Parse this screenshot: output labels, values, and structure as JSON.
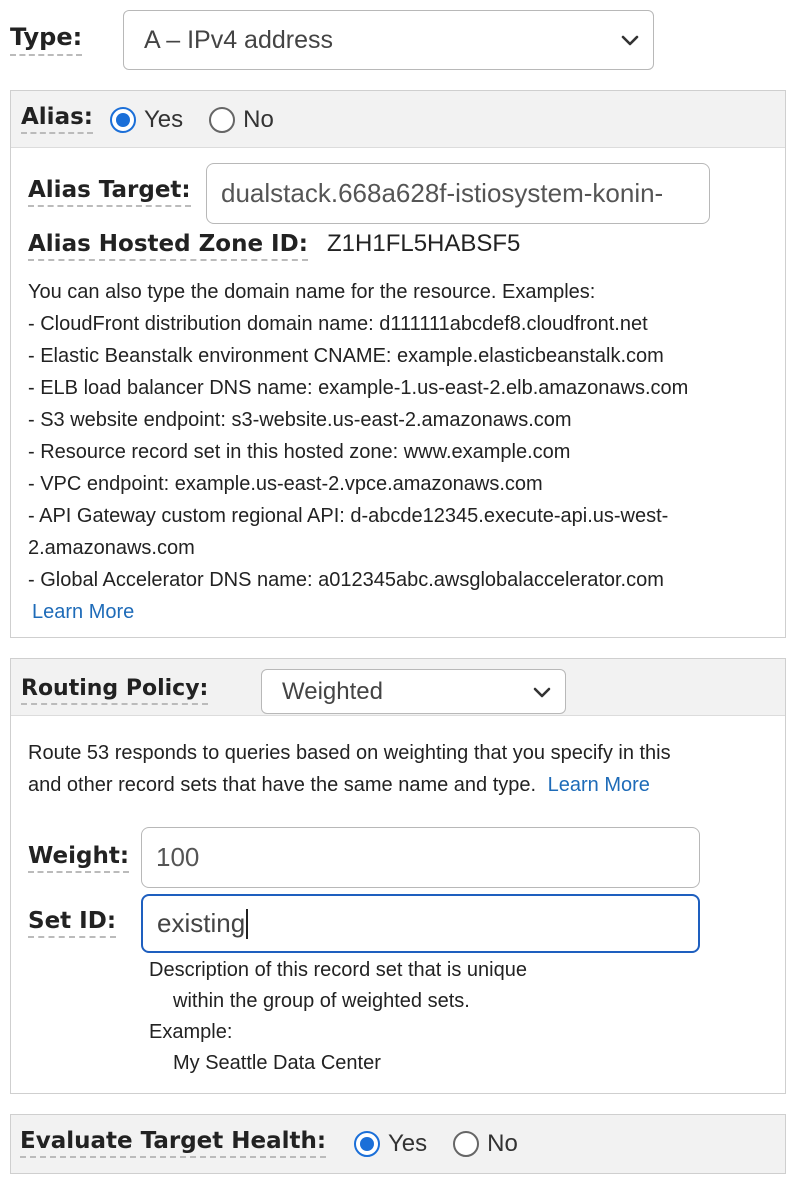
{
  "type_row": {
    "label": "Type:",
    "selected": "A – IPv4 address"
  },
  "alias": {
    "label": "Alias:",
    "options": [
      {
        "label": "Yes",
        "checked": true
      },
      {
        "label": "No",
        "checked": false
      }
    ],
    "target_label": "Alias Target:",
    "target_value": "dualstack.668a628f-istiosystem-konin-",
    "zone_label": "Alias Hosted Zone ID:",
    "zone_value": "Z1H1FL5HABSF5",
    "help_intro": "You can also type the domain name for the resource. Examples:",
    "examples": [
      "-  CloudFront distribution domain name: d111111abcdef8.cloudfront.net",
      "-  Elastic Beanstalk environment CNAME: example.elasticbeanstalk.com",
      "-  ELB load balancer DNS name: example-1.us-east-2.elb.amazonaws.com",
      "-  S3 website endpoint: s3-website.us-east-2.amazonaws.com",
      "-  Resource record set in this hosted zone: www.example.com",
      "-  VPC endpoint: example.us-east-2.vpce.amazonaws.com",
      "-  API Gateway custom regional API: d-abcde12345.execute-api.us-west-",
      "2.amazonaws.com",
      "-  Global Accelerator DNS name: a012345abc.awsglobalaccelerator.com"
    ],
    "learn_more": "Learn More"
  },
  "routing": {
    "label": "Routing Policy:",
    "selected": "Weighted",
    "description_line1": "Route 53 responds to queries based on weighting that you specify in this",
    "description_line2": "and other record sets that have the same name and type.",
    "learn_more": "Learn More",
    "weight_label": "Weight:",
    "weight_value": "100",
    "setid_label": "Set ID:",
    "setid_value": "existing",
    "setid_help_1": "Description of this record set that is unique",
    "setid_help_2": "within the group of weighted sets.",
    "setid_help_3": "Example:",
    "setid_help_4": "My Seattle Data Center"
  },
  "health": {
    "label": "Evaluate Target Health:",
    "options": [
      {
        "label": "Yes",
        "checked": true
      },
      {
        "label": "No",
        "checked": false
      }
    ]
  },
  "icons": {
    "select_arrow": "chevron-down-icon"
  },
  "colors": {
    "radio_checked": "#1b6fd8",
    "link": "#1e6bb8",
    "focus_border": "#1e5fbf",
    "panel_header": "#f2f2f2"
  }
}
